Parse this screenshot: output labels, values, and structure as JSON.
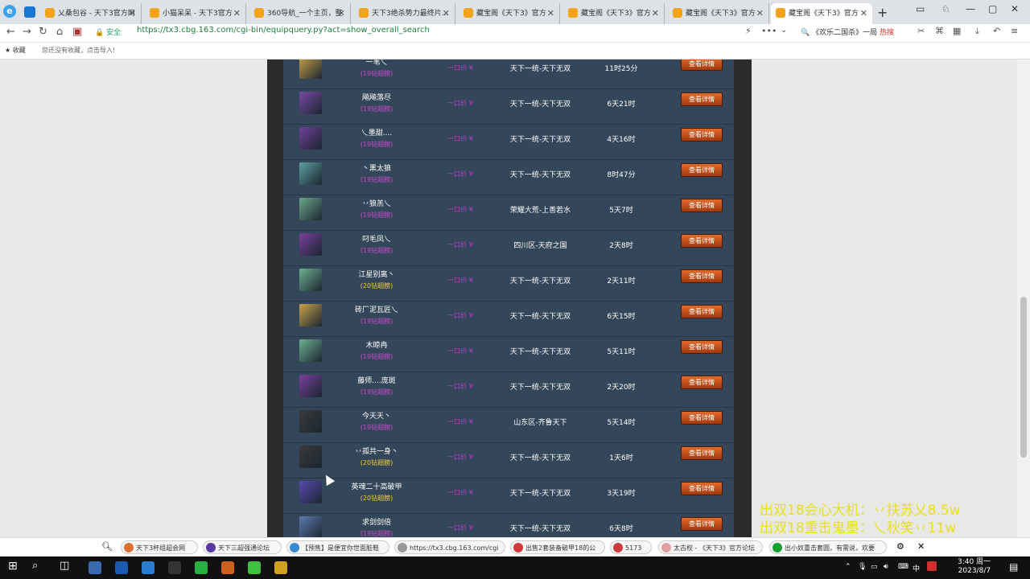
{
  "browser": {
    "tabs": [
      {
        "label": "乂桑包谷 - 天下3官方网"
      },
      {
        "label": "小猫呆呆 - 天下3官方"
      },
      {
        "label": "360导航_一个主页，整"
      },
      {
        "label": "天下3绝杀势力最终片..."
      },
      {
        "label": "藏宝阁《天下3》官方"
      },
      {
        "label": "藏宝阁《天下3》官方"
      },
      {
        "label": "藏宝阁《天下3》官方"
      },
      {
        "label": "藏宝阁《天下3》官方"
      }
    ],
    "url": "https://tx3.cbg.163.com/cgi-bin/equipquery.py?act=show_overall_search",
    "secure_label": "安全",
    "right_search": "《欢乐二国杀》一局",
    "right_badge": "热搜",
    "bookmarks": [
      "收藏",
      "您还没有收藏，点击导入!"
    ]
  },
  "table": {
    "button_label": "查看详情",
    "rows": [
      {
        "name": "一苇乀",
        "sub": "(19钻翅膀)",
        "sub_gold": false,
        "price": "一口价 ¥",
        "server": "天下一统-天下无双",
        "time": "11时25分",
        "avatar_color": "#c9a24a"
      },
      {
        "name": "飚飚落尽",
        "sub": "(19钻翅膀)",
        "sub_gold": false,
        "price": "一口价 ¥",
        "server": "天下一统-天下无双",
        "time": "6天21时",
        "avatar_color": "#7a4aa8"
      },
      {
        "name": "乀墨甜....",
        "sub": "(19钻翅膀)",
        "sub_gold": false,
        "price": "一口价 ¥",
        "server": "天下一统-天下无双",
        "time": "4天16时",
        "avatar_color": "#6f3f9c"
      },
      {
        "name": "丶黑太狼",
        "sub": "(19钻翅膀)",
        "sub_gold": false,
        "price": "一口价 ¥",
        "server": "天下一统-天下无双",
        "time": "8时47分",
        "avatar_color": "#5aa0a0"
      },
      {
        "name": "丷狼羔乀",
        "sub": "(19钻翅膀)",
        "sub_gold": false,
        "price": "一口价 ¥",
        "server": "荣耀大荒-上善若水",
        "time": "5天7时",
        "avatar_color": "#6aa88a"
      },
      {
        "name": "叼毛凤乀",
        "sub": "(19钻翅膀)",
        "sub_gold": false,
        "price": "一口价 ¥",
        "server": "四川区-天府之国",
        "time": "2天8时",
        "avatar_color": "#7a3fa0"
      },
      {
        "name": "江星别离丶",
        "sub": "(20钻翅膀)",
        "sub_gold": true,
        "price": "一口价 ¥",
        "server": "天下一统-天下无双",
        "time": "2天11时",
        "avatar_color": "#6ab090"
      },
      {
        "name": "砖厂泥瓦匠乀",
        "sub": "(19钻翅膀)",
        "sub_gold": false,
        "price": "一口价 ¥",
        "server": "天下一统-天下无双",
        "time": "6天15时",
        "avatar_color": "#c9a24a"
      },
      {
        "name": "木晾冉",
        "sub": "(19钻翅膀)",
        "sub_gold": false,
        "price": "一口价 ¥",
        "server": "天下一统-天下无双",
        "time": "5天11时",
        "avatar_color": "#6ab090"
      },
      {
        "name": "藤师....庞斑",
        "sub": "(19钻翅膀)",
        "sub_gold": false,
        "price": "一口价 ¥",
        "server": "天下一统-天下无双",
        "time": "2天20时",
        "avatar_color": "#7a3fa0"
      },
      {
        "name": "今天天丶",
        "sub": "(19钻翅膀)",
        "sub_gold": false,
        "price": "一口价 ¥",
        "server": "山东区-齐鲁天下",
        "time": "5天14时",
        "avatar_color": "#3a3a3a"
      },
      {
        "name": "丷孤共一身丶",
        "sub": "(20钻翅膀)",
        "sub_gold": true,
        "price": "一口价 ¥",
        "server": "天下一统-天下无双",
        "time": "1天6时",
        "avatar_color": "#3a3a3a"
      },
      {
        "name": "英魂二十高破甲",
        "sub": "(20钻翅膀)",
        "sub_gold": true,
        "price": "一口价 ¥",
        "server": "天下一统-天下无双",
        "time": "3天19时",
        "avatar_color": "#5a4ab0"
      },
      {
        "name": "求剑剑倍",
        "sub": "(19钻翅膀)",
        "sub_gold": false,
        "price": "一口价 ¥",
        "server": "天下一统-天下无双",
        "time": "6天8时",
        "avatar_color": "#5a7ab0"
      }
    ]
  },
  "overlay": {
    "line1": "出双18会心大机：丷扶苏乂8.5w",
    "line2": "出双18重击鬼墨：乀秋笑丷11w"
  },
  "bottom_tabs": [
    {
      "label": "天下3杯组超会网",
      "color": "#e07030"
    },
    {
      "label": "天下三超强通论坛",
      "color": "#5a3aa0"
    },
    {
      "label": "【预售】是便宜你世面脏鞋",
      "color": "#3a8ad0"
    },
    {
      "label": "https://tx3.cbg.163.com/cgi",
      "color": "#999999"
    },
    {
      "label": "出售2套装备破甲18的公",
      "color": "#d03a3a"
    },
    {
      "label": "5173",
      "color": "#d03a3a"
    },
    {
      "label": "太古权 - 《天下3》官方论坛",
      "color": "#e0a0a0"
    },
    {
      "label": "出小奴重击套圆，有需说，欢要",
      "color": "#1aa030"
    }
  ],
  "clock": {
    "time": "3:40 周一",
    "date": "2023/8/7"
  },
  "tray_ime": "中"
}
